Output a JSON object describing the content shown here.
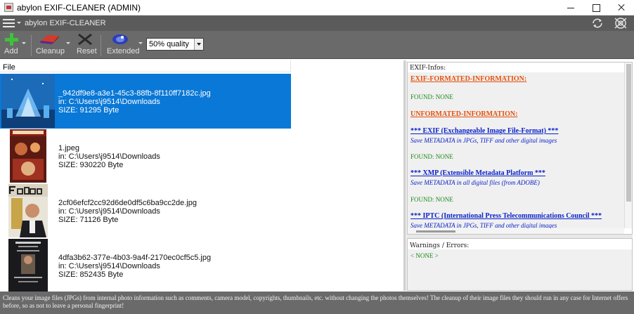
{
  "window": {
    "title": "abylon EXIF-CLEANER (ADMIN)"
  },
  "appbar": {
    "name": "abylon EXIF-CLEANER",
    "icons": [
      "menu-icon",
      "refresh-icon",
      "help-icon"
    ]
  },
  "toolbar": {
    "add_label": "Add",
    "cleanup_label": "Cleanup",
    "reset_label": "Reset",
    "extended_label": "Extended",
    "quality_value": "50% quality"
  },
  "filelist": {
    "column_header": "File",
    "files": [
      {
        "name": "_942df9e8-a3e1-45c3-88fb-8f110ff7182c.jpg",
        "location": "in: C:\\Users\\j9514\\Downloads",
        "size": "SIZE: 91295 Byte",
        "selected": true
      },
      {
        "name": "1.jpeg",
        "location": "in: C:\\Users\\j9514\\Downloads",
        "size": "SIZE: 930220 Byte",
        "selected": false
      },
      {
        "name": "2cf06efcf2cc92d6de0df5c6ba9cc2de.jpg",
        "location": "in: C:\\Users\\j9514\\Downloads",
        "size": "SIZE: 71126 Byte",
        "selected": false
      },
      {
        "name": "4dfa3b62-377e-4b03-9a4f-2170ec0cf5c5.jpg",
        "location": "in: C:\\Users\\j9514\\Downloads",
        "size": "SIZE: 852435 Byte",
        "selected": false
      }
    ]
  },
  "exif": {
    "header": "EXIF-Infos:",
    "formatted_title": "EXIF-FORMATED-INFORMATION:",
    "found_1": "FOUND: NONE",
    "unformatted_title": "UNFORMATED-INFORMATION:",
    "exif_title": "*** EXIF (Exchangeable Image File-Format) ***",
    "exif_desc": "Save METADATA in JPGs, TIFF and other digital images",
    "found_2": "FOUND: NONE",
    "xmp_title": "*** XMP (Extensible Metadata Platform ***",
    "xmp_desc": "Save METADATA in all digital files (from ADOBE)",
    "found_3": "FOUND: NONE",
    "iptc_title": "*** IPTC (International Press Telecommunications Council ***",
    "iptc_desc": "Save METADATA in JPGs, TIFF and other digital images"
  },
  "warnings": {
    "header": "Warnings / Errors:",
    "value": "< NONE >"
  },
  "statusbar": {
    "text": "Cleans your image files (JPGs) from internal photo information such as comments, camera model, copyrights, thumbnails, etc. without changing the photos themselves! The cleanup of their image files they should run in any case for Internet offers before, so as not to leave a personal fingerprint!"
  },
  "colors": {
    "selection": "#0a78d7",
    "toolbar": "#6a6a6a",
    "heading_red": "#e4500a",
    "heading_blue": "#0a22c8",
    "found_green": "#1a8a1a"
  }
}
